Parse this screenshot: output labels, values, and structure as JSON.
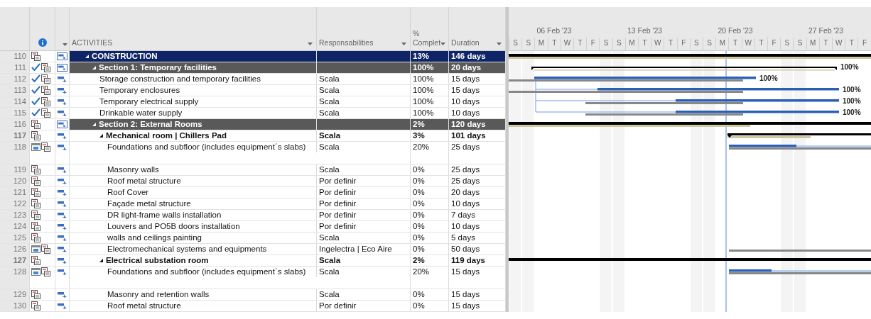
{
  "table": {
    "columns": [
      {
        "label": "ACTIVITIES"
      },
      {
        "label": "Responsabilities"
      },
      {
        "label": "% Complet"
      },
      {
        "label": "Duration"
      }
    ],
    "rows": [
      {
        "id": "110",
        "name": "CONSTRUCTION",
        "complete": "13%",
        "duration": "146 days",
        "kind": "project",
        "completed": false,
        "calendar": false,
        "expanded": true,
        "tall": false,
        "children": [
          {
            "id": "111",
            "name": "Section 1: Temporary facilities",
            "complete": "100%",
            "duration": "20 days",
            "kind": "section",
            "completed": true,
            "calendar": false,
            "expanded": true,
            "tall": false,
            "bar_label": "100%",
            "children": [
              {
                "id": "112",
                "name": "Storage construction and temporary facilities",
                "responsible": "Scala",
                "complete": "100%",
                "duration": "15 days",
                "kind": "task",
                "completed": true,
                "calendar": false,
                "tall": false,
                "bar_label": "100%"
              },
              {
                "id": "113",
                "name": "Temporary enclosures",
                "responsible": "Scala",
                "complete": "100%",
                "duration": "15 days",
                "kind": "task",
                "completed": true,
                "calendar": false,
                "tall": false,
                "bar_label": "100%"
              },
              {
                "id": "114",
                "name": "Temporary electrical supply",
                "responsible": "Scala",
                "complete": "100%",
                "duration": "10 days",
                "kind": "task",
                "completed": true,
                "calendar": false,
                "tall": false,
                "bar_label": "100%"
              },
              {
                "id": "115",
                "name": "Drinkable water supply",
                "responsible": "Scala",
                "complete": "100%",
                "duration": "10 days",
                "kind": "task",
                "completed": true,
                "calendar": false,
                "tall": false,
                "bar_label": "100%"
              }
            ]
          },
          {
            "id": "116",
            "name": "Section 2: External Rooms",
            "complete": "2%",
            "duration": "120 days",
            "kind": "section",
            "completed": false,
            "calendar": false,
            "expanded": true,
            "tall": false,
            "children": [
              {
                "id": "117",
                "name": "Mechanical room | Chillers Pad",
                "responsible": "Scala",
                "complete": "3%",
                "duration": "101 days",
                "kind": "group",
                "completed": false,
                "calendar": false,
                "expanded": true,
                "tall": false,
                "children": [
                  {
                    "id": "118",
                    "name": "Foundations and subfloor (includes equipment´s slabs)",
                    "responsible": "Scala",
                    "complete": "20%",
                    "duration": "25 days",
                    "kind": "task",
                    "completed": false,
                    "calendar": true,
                    "tall": true
                  },
                  {
                    "id": "119",
                    "name": "Masonry walls",
                    "responsible": "Scala",
                    "complete": "0%",
                    "duration": "25 days",
                    "kind": "task",
                    "completed": false,
                    "calendar": false,
                    "tall": false
                  },
                  {
                    "id": "120",
                    "name": "Roof metal structure",
                    "responsible": "Por definir",
                    "complete": "0%",
                    "duration": "25 days",
                    "kind": "task",
                    "completed": false,
                    "calendar": false,
                    "tall": false
                  },
                  {
                    "id": "121",
                    "name": "Roof Cover",
                    "responsible": "Por definir",
                    "complete": "0%",
                    "duration": "20 days",
                    "kind": "task",
                    "completed": false,
                    "calendar": false,
                    "tall": false
                  },
                  {
                    "id": "122",
                    "name": "Façade metal structure",
                    "responsible": "Por definir",
                    "complete": "0%",
                    "duration": "10 days",
                    "kind": "task",
                    "completed": false,
                    "calendar": false,
                    "tall": false
                  },
                  {
                    "id": "123",
                    "name": "DR light-frame walls installation",
                    "responsible": "Por definir",
                    "complete": "0%",
                    "duration": "7 days",
                    "kind": "task",
                    "completed": false,
                    "calendar": false,
                    "tall": false
                  },
                  {
                    "id": "124",
                    "name": "Louvers and PO5B doors installation",
                    "responsible": "Por definir",
                    "complete": "0%",
                    "duration": "10 days",
                    "kind": "task",
                    "completed": false,
                    "calendar": false,
                    "tall": false
                  },
                  {
                    "id": "125",
                    "name": "walls and ceilings painting",
                    "responsible": "Scala",
                    "complete": "0%",
                    "duration": "5 days",
                    "kind": "task",
                    "completed": false,
                    "calendar": false,
                    "tall": false
                  },
                  {
                    "id": "126",
                    "name": "Electromechanical systems and equipments",
                    "responsible": "Ingelectra | Eco Aire",
                    "complete": "0%",
                    "duration": "50 days",
                    "kind": "task",
                    "completed": false,
                    "calendar": true,
                    "tall": false
                  }
                ]
              },
              {
                "id": "127",
                "name": "Electrical substation room",
                "responsible": "Scala",
                "complete": "2%",
                "duration": "119 days",
                "kind": "group",
                "completed": false,
                "calendar": false,
                "expanded": true,
                "tall": false,
                "children": [
                  {
                    "id": "128",
                    "name": "Foundations and subfloor (includes equipment´s slabs)",
                    "responsible": "Scala",
                    "complete": "20%",
                    "duration": "15 days",
                    "kind": "task",
                    "completed": false,
                    "calendar": true,
                    "tall": true
                  },
                  {
                    "id": "129",
                    "name": "Masonry and retention walls",
                    "responsible": "Scala",
                    "complete": "0%",
                    "duration": "15 days",
                    "kind": "task",
                    "completed": false,
                    "calendar": false,
                    "tall": false
                  },
                  {
                    "id": "130",
                    "name": "Roof metal structure",
                    "responsible": "Por definir",
                    "complete": "0%",
                    "duration": "15 days",
                    "kind": "task",
                    "completed": false,
                    "calendar": false,
                    "tall": false
                  }
                ]
              }
            ]
          }
        ]
      }
    ]
  },
  "gantt": {
    "weeks": [
      "06 Feb '23",
      "13 Feb '23",
      "20 Feb '23",
      "27 Feb '23"
    ],
    "days": [
      "S",
      "S",
      "M",
      "T",
      "W",
      "T",
      "F",
      "S",
      "S",
      "M",
      "T",
      "W",
      "T",
      "F",
      "S",
      "S",
      "M",
      "T",
      "W",
      "T",
      "F",
      "S",
      "S",
      "M",
      "T",
      "W",
      "T",
      "F"
    ]
  }
}
